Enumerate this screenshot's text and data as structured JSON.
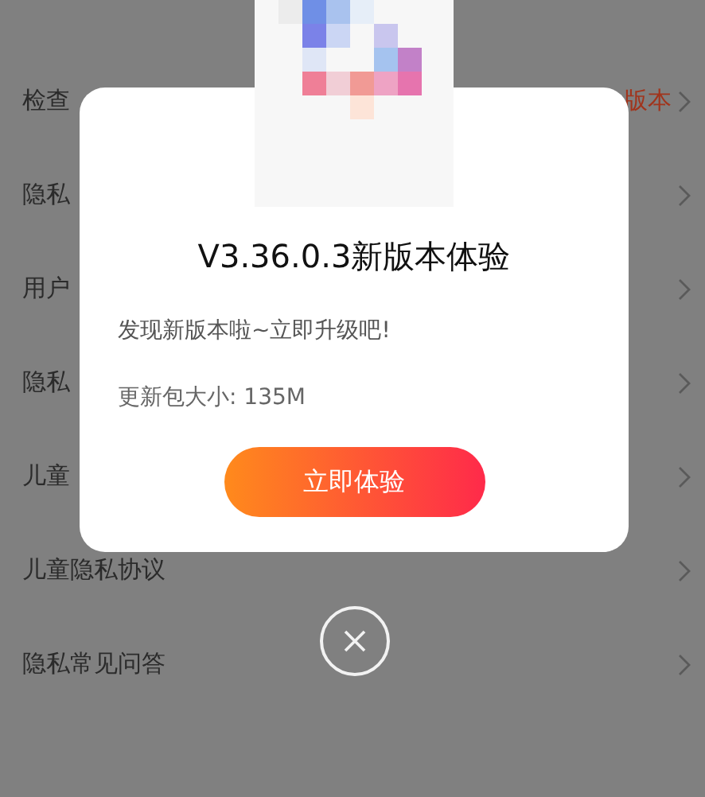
{
  "settings": [
    {
      "label": "检查",
      "value": "版本"
    },
    {
      "label": "隐私"
    },
    {
      "label": "用户"
    },
    {
      "label": "隐私"
    },
    {
      "label": "儿童"
    },
    {
      "label": "儿童隐私协议"
    },
    {
      "label": "隐私常见问答"
    }
  ],
  "dialog": {
    "title": "V3.36.0.3新版本体验",
    "message": "发现新版本啦~立即升级吧!",
    "size": "更新包大小: 135M",
    "button": "立即体验"
  }
}
